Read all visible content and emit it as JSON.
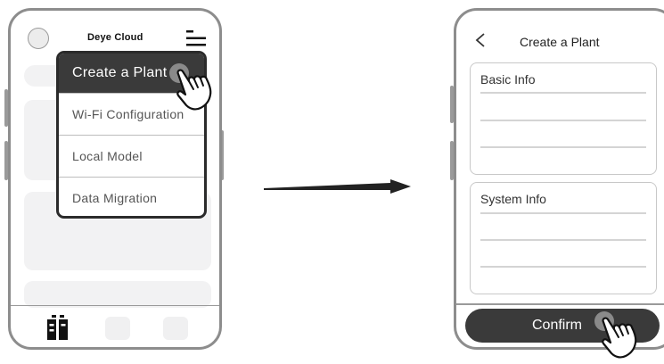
{
  "left_screen": {
    "app_name": "Deye Cloud",
    "menu": [
      {
        "label": "Create a Plant",
        "active": true
      },
      {
        "label": "Wi-Fi Configuration",
        "active": false
      },
      {
        "label": "Local Model",
        "active": false
      },
      {
        "label": "Data Migration",
        "active": false
      }
    ]
  },
  "right_screen": {
    "title": "Create a Plant",
    "sections": [
      {
        "label": "Basic Info"
      },
      {
        "label": "System Info"
      }
    ],
    "confirm_label": "Confirm"
  },
  "icons": {
    "back": "chevron-left-icon",
    "menu": "hamburger-menu-icon",
    "tap": "tap-hand-icon",
    "flow": "arrow-right-icon",
    "home_tab": "station-icon"
  },
  "colors": {
    "frame": "#8d8d8d",
    "dark": "#3a3a3a",
    "placeholder": "#f2f2f3"
  }
}
